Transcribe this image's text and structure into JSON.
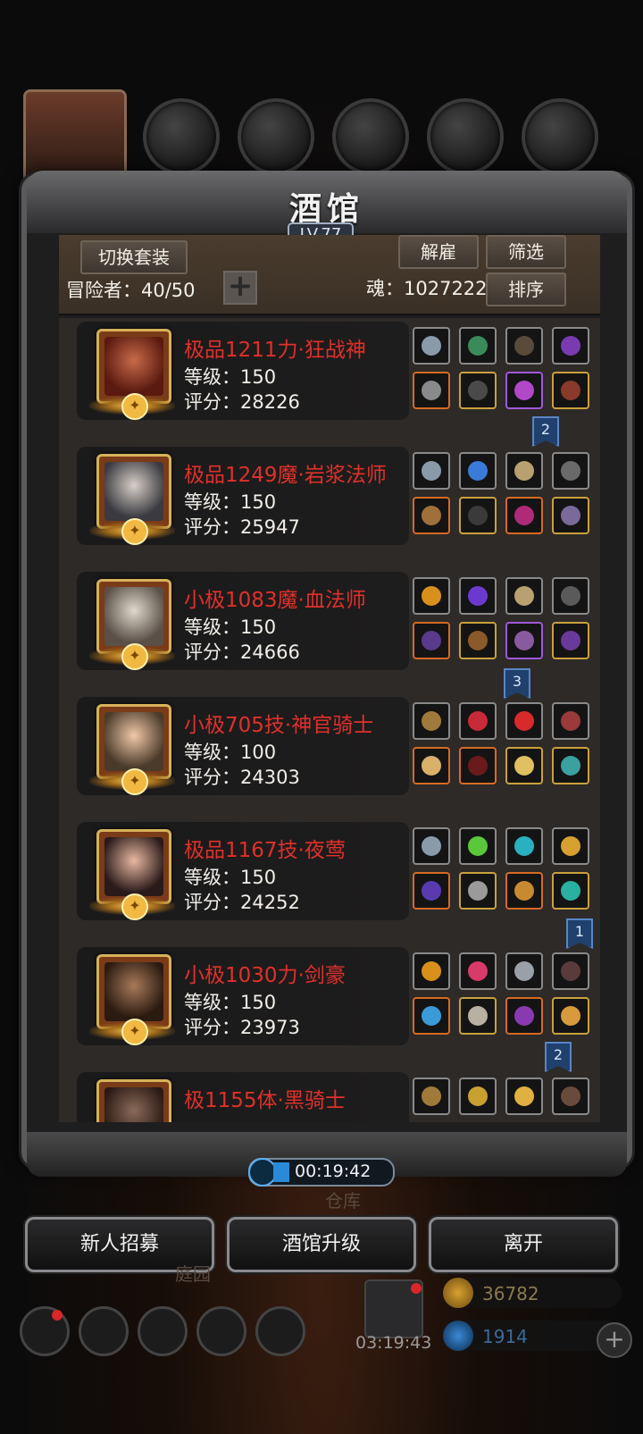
{
  "panel": {
    "title": "酒馆",
    "level": "LV.77",
    "switch_outfit": "切换套装",
    "dismiss": "解雇",
    "filter": "筛选",
    "sort": "排序",
    "adventurers_label": "冒险者：40/50",
    "soul_label": "魂：1027222",
    "add_symbol": "+"
  },
  "heroes": [
    {
      "name": "极品1211力·狂战神",
      "level": "等级：150",
      "score": "评分：28226"
    },
    {
      "name": "极品1249魔·岩浆法师",
      "level": "等级：150",
      "score": "评分：25947"
    },
    {
      "name": "小极1083魔·血法师",
      "level": "等级：150",
      "score": "评分：24666"
    },
    {
      "name": "小极705技·神官骑士",
      "level": "等级：100",
      "score": "评分：24303"
    },
    {
      "name": "极品1167技·夜莺",
      "level": "等级：150",
      "score": "评分：24252"
    },
    {
      "name": "小极1030力·剑豪",
      "level": "等级：150",
      "score": "评分：23973"
    },
    {
      "name": "极1155体·黑骑士",
      "level": "",
      "score": ""
    }
  ],
  "badges": [
    "2",
    "3",
    "1",
    "2"
  ],
  "timer": "00:19:42",
  "bottom_buttons": {
    "recruit": "新人招募",
    "upgrade": "酒馆升级",
    "leave": "离开"
  },
  "background_text": {
    "warehouse": "仓库",
    "garden": "庭园",
    "gift_timer": "03:19:43",
    "gold": "36782",
    "gems": "1914"
  },
  "colors": {
    "hero_name": "#e0302a",
    "panel_bg": "#2d2a28",
    "badge": "#20406e"
  }
}
